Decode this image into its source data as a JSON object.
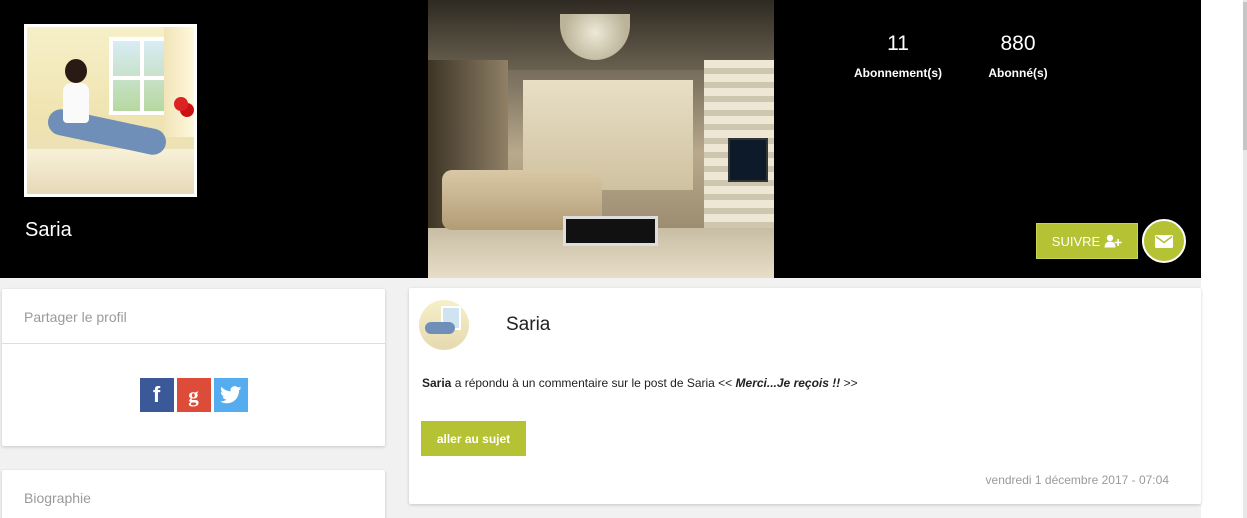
{
  "profile": {
    "name": "Saria",
    "stats": [
      {
        "value": "11",
        "label": "Abonnement(s)"
      },
      {
        "value": "880",
        "label": "Abonné(s)"
      }
    ],
    "follow_label": "SUIVRE",
    "follow_icon": "user-plus-icon",
    "message_icon": "envelope-icon",
    "accent_color": "#b5c233"
  },
  "share": {
    "title": "Partager le profil",
    "facebook_glyph": "f",
    "google_glyph": "g",
    "twitter_icon": "twitter-bird-icon"
  },
  "bio": {
    "title": "Biographie"
  },
  "feed": {
    "author": "Saria",
    "actor": "Saria",
    "text": " a répondu à un commentaire sur le post de Saria << ",
    "quote": "Merci...Je reçois !!",
    "closing": " >>",
    "button_label": "aller au sujet",
    "date": "vendredi 1 décembre 2017 - 07:04"
  }
}
